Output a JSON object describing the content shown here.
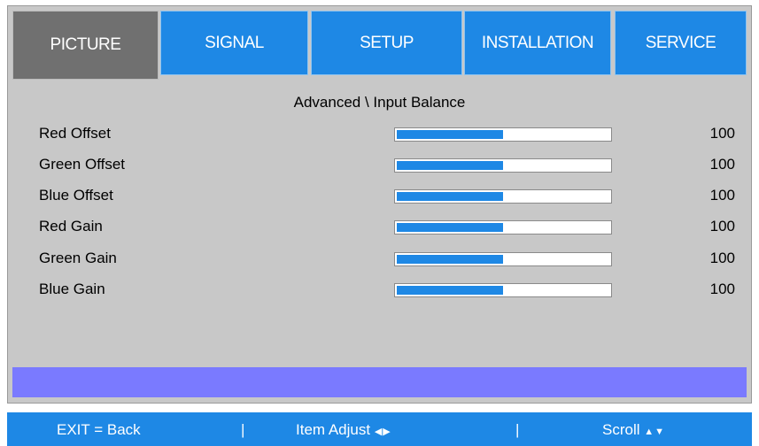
{
  "tabs": [
    {
      "label": "PICTURE",
      "active": true
    },
    {
      "label": "SIGNAL",
      "active": false
    },
    {
      "label": "SETUP",
      "active": false
    },
    {
      "label": "INSTALLATION",
      "active": false
    },
    {
      "label": "SERVICE",
      "active": false
    }
  ],
  "menu": {
    "heading": "Advanced \\ Input Balance",
    "items": [
      {
        "label": "Red Offset",
        "value": "100",
        "level": 0.5
      },
      {
        "label": "Green Offset",
        "value": "100",
        "level": 0.5
      },
      {
        "label": "Blue Offset",
        "value": "100",
        "level": 0.5
      },
      {
        "label": "Red Gain",
        "value": "100",
        "level": 0.5
      },
      {
        "label": "Green Gain",
        "value": "100",
        "level": 0.5
      },
      {
        "label": "Blue Gain",
        "value": "100",
        "level": 0.5
      }
    ]
  },
  "footer": {
    "exit": "EXIT = Back",
    "separator": "|",
    "item_adjust": "Item Adjust",
    "item_adjust_icon": "◀▶",
    "scroll": "Scroll",
    "scroll_icon": "▲▼"
  },
  "colors": {
    "tab_blue": "#1e88e5",
    "tab_active": "#707070",
    "panel_bg": "#c8c8c8",
    "highlight": "#7a7aff"
  }
}
